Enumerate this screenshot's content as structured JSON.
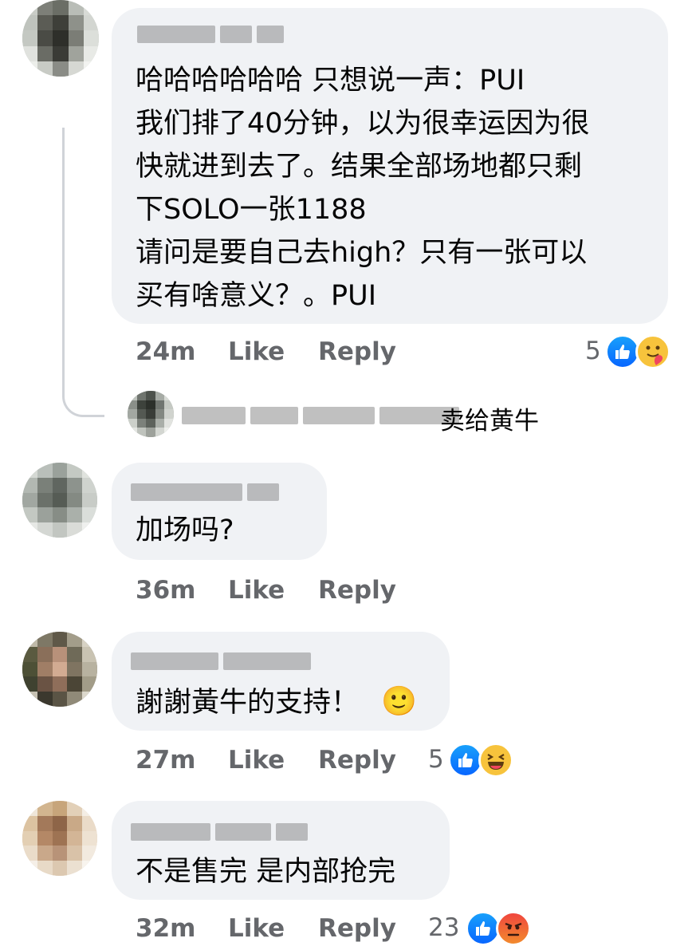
{
  "comments": [
    {
      "text_lines": [
        "哈哈哈哈哈哈 只想说一声：PUI",
        "我们排了40分钟，以为很幸运因为很",
        "快就进到去了。结果全部场地都只剩",
        "下SOLO一张1188",
        "请问是要自己去high？只有一张可以",
        "买有啥意义？。PUI"
      ],
      "time": "24m",
      "like_label": "Like",
      "reply_label": "Reply",
      "reaction_count": "5",
      "reactions": [
        "like-icon",
        "care-icon"
      ]
    },
    {
      "text_lines": [
        "加场吗?"
      ],
      "time": "36m",
      "like_label": "Like",
      "reply_label": "Reply"
    },
    {
      "text_lines": [
        "謝謝黃牛的支持！"
      ],
      "emoji": "🙂",
      "time": "27m",
      "like_label": "Like",
      "reply_label": "Reply",
      "reaction_count": "5",
      "reactions": [
        "like-icon",
        "haha-icon"
      ]
    },
    {
      "text_lines": [
        "不是售完 是内部抢完"
      ],
      "time": "32m",
      "like_label": "Like",
      "reply_label": "Reply",
      "reaction_count": "23",
      "reactions": [
        "like-icon",
        "angry-icon"
      ]
    }
  ],
  "reply_preview": {
    "text_visible": "卖给黄牛"
  },
  "colors": {
    "bubble": "#f0f2f5",
    "meta_text": "#65676b",
    "like_blue": "#0866ff",
    "reaction_yellow": "#f7c33c",
    "angry_red": "#f0463e"
  }
}
